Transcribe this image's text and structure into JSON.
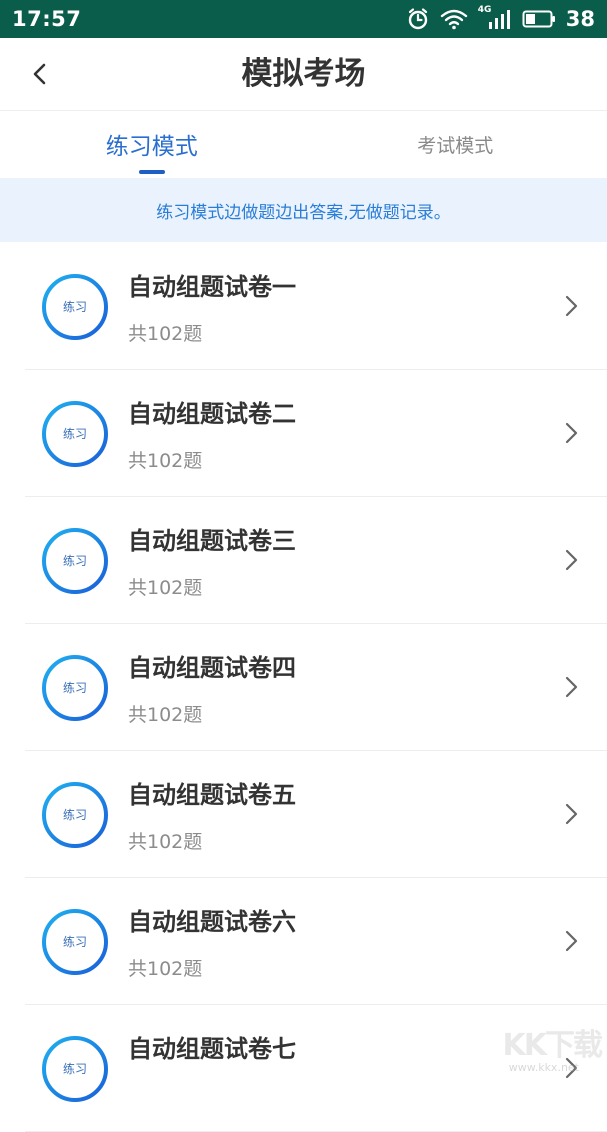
{
  "status_bar": {
    "time": "17:57",
    "battery_level": "38",
    "icons": [
      "alarm-icon",
      "wifi-icon",
      "signal-4g-icon",
      "battery-icon"
    ],
    "network_label": "4G",
    "background_color": "#0b5d4b"
  },
  "nav": {
    "title": "模拟考场",
    "back_icon": "chevron-left-icon"
  },
  "tabs": [
    {
      "label": "练习模式",
      "active": true
    },
    {
      "label": "考试模式",
      "active": false
    }
  ],
  "notice": "练习模式边做题边出答案,无做题记录。",
  "badge_label": "练习",
  "items": [
    {
      "title": "自动组题试卷一",
      "subtitle": "共102题"
    },
    {
      "title": "自动组题试卷二",
      "subtitle": "共102题"
    },
    {
      "title": "自动组题试卷三",
      "subtitle": "共102题"
    },
    {
      "title": "自动组题试卷四",
      "subtitle": "共102题"
    },
    {
      "title": "自动组题试卷五",
      "subtitle": "共102题"
    },
    {
      "title": "自动组题试卷六",
      "subtitle": "共102题"
    },
    {
      "title": "自动组题试卷七",
      "subtitle": ""
    }
  ],
  "watermark": {
    "main": "KK下载",
    "sub": "www.kkx.net"
  },
  "colors": {
    "accent": "#2a6fd0",
    "notice_bg": "#eaf3fd",
    "ring_gradient_start": "#1fb0f0",
    "ring_gradient_end": "#1a5fd8"
  }
}
